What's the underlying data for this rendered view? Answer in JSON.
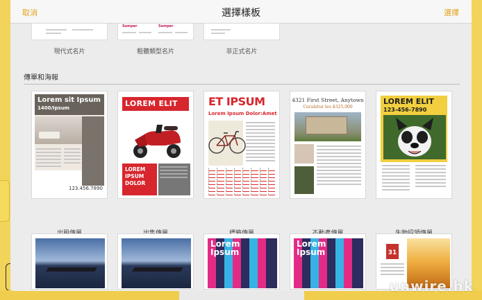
{
  "nav": {
    "cancel": "取消",
    "title": "選擇樣板",
    "choose": "選擇"
  },
  "top_row": [
    {
      "label": "現代式名片",
      "brand": ""
    },
    {
      "label": "粗體類型名片",
      "brand": "Semper"
    },
    {
      "label": "非正式名片",
      "brand": ""
    }
  ],
  "section": {
    "title": "傳單和海報"
  },
  "templates": [
    {
      "label": "出租傳單",
      "headline": "Lorem sit Ipsum",
      "sub": "1400/Ipsum",
      "footer": "123.456.7890"
    },
    {
      "label": "出售傳單",
      "headline": "LOREM ELIT",
      "box_text": "LOREM IPSUM DOLOR"
    },
    {
      "label": "標籤傳單",
      "headline": "ET IPSUM",
      "sub": "Lorem Ipsum Dolor:Amet"
    },
    {
      "label": "不動產傳單",
      "headline": "4321 First Street, Anytown",
      "sub": "Curabitur leo $325,000"
    },
    {
      "label": "失物招領傳單",
      "headline": "LOREM ELIT",
      "sub": "123-456-7890"
    }
  ],
  "bottom_row": [
    {
      "text": ""
    },
    {
      "text": ""
    },
    {
      "text": "Lorem Ipsum"
    },
    {
      "text": "Lorem Ipsum"
    },
    {
      "text": "31"
    }
  ],
  "watermark": "unwire.hk",
  "colors": {
    "accent": "#e3a21a",
    "flyer_red": "#d7262d",
    "backdrop_yellow": "#f3d45a"
  }
}
